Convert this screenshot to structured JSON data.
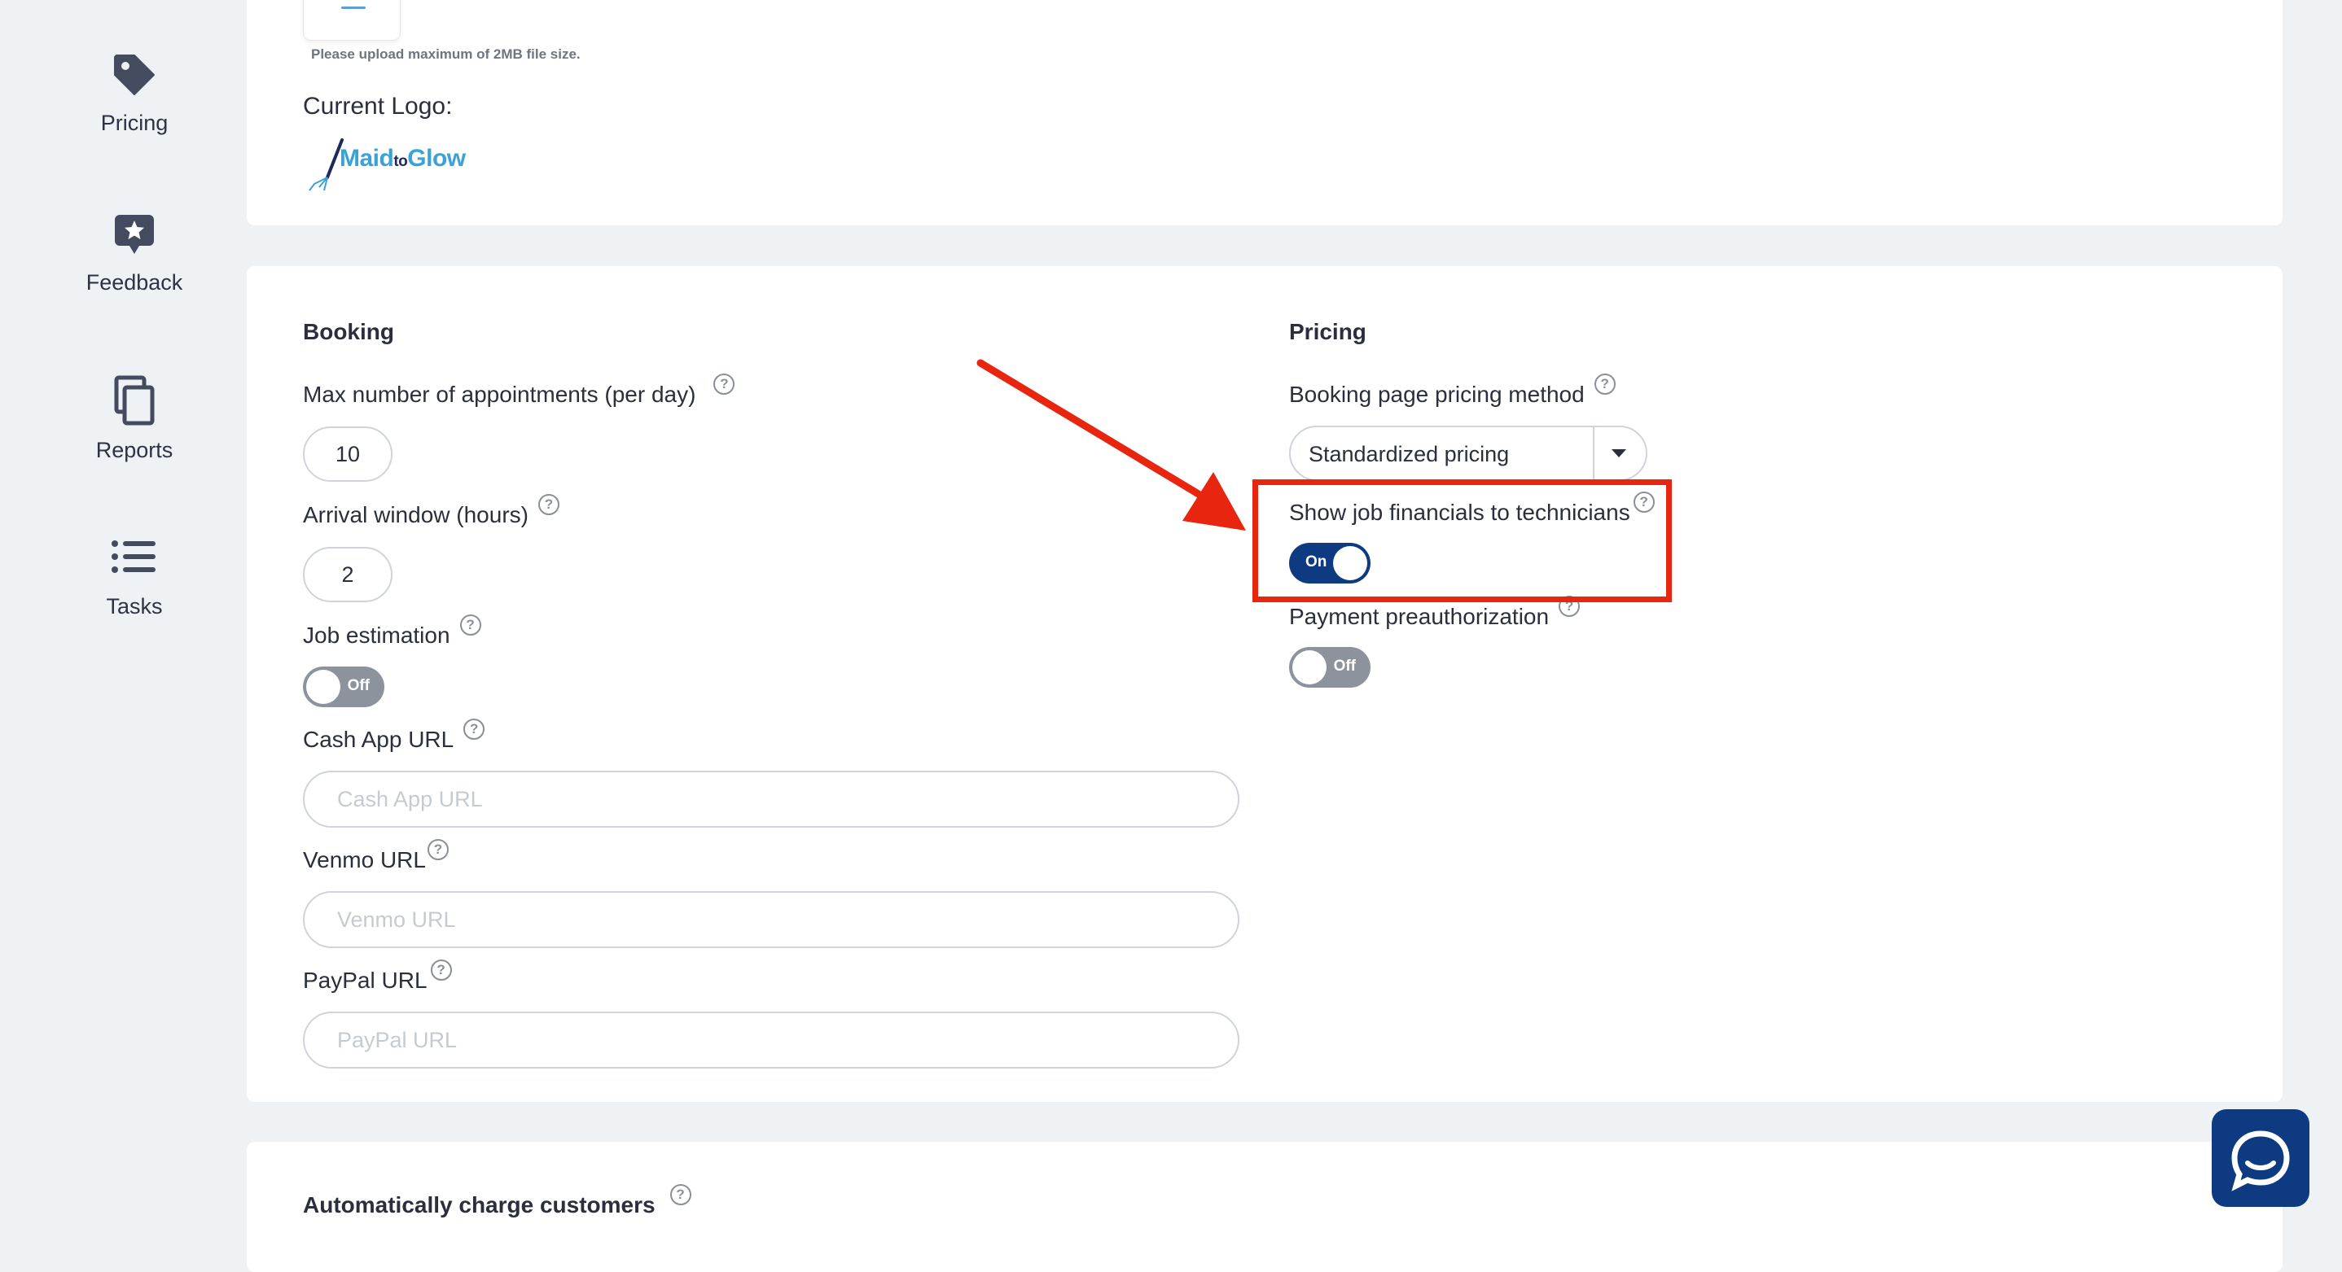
{
  "sidebar": {
    "items": [
      {
        "label": "Pricing",
        "icon": "tag-icon"
      },
      {
        "label": "Feedback",
        "icon": "star-bubble-icon"
      },
      {
        "label": "Reports",
        "icon": "copy-icon"
      },
      {
        "label": "Tasks",
        "icon": "list-icon"
      }
    ]
  },
  "logo_section": {
    "upload_note": "Please upload maximum of 2MB file size.",
    "current_logo_label": "Current Logo:",
    "logo_brand": "MaidtoGlow"
  },
  "booking": {
    "title": "Booking",
    "max_appointments_label": "Max number of appointments (per day)",
    "max_appointments_value": "10",
    "arrival_window_label": "Arrival window (hours)",
    "arrival_window_value": "2",
    "job_estimation_label": "Job estimation",
    "job_estimation_state": "Off",
    "cash_app_label": "Cash App URL",
    "cash_app_placeholder": "Cash App URL",
    "venmo_label": "Venmo URL",
    "venmo_placeholder": "Venmo URL",
    "paypal_label": "PayPal URL",
    "paypal_placeholder": "PayPal URL"
  },
  "pricing": {
    "title": "Pricing",
    "method_label": "Booking page pricing method",
    "method_value": "Standardized pricing",
    "show_financials_label": "Show job financials to technicians",
    "show_financials_state": "On",
    "preauth_label": "Payment preauthorization",
    "preauth_state": "Off"
  },
  "auto_charge": {
    "title": "Automatically charge customers"
  },
  "colors": {
    "accent": "#0e3a82",
    "annotation": "#e8260f",
    "toggle_off": "#8c939c",
    "background": "#eef2f5"
  }
}
